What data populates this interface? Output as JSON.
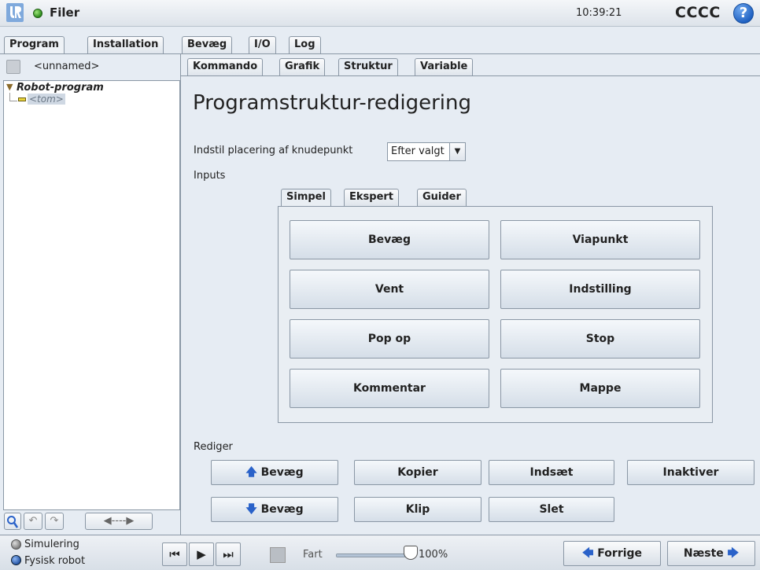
{
  "header": {
    "app_title": "Filer",
    "clock": "10:39:21",
    "robot_name": "CCCC",
    "help_glyph": "?"
  },
  "main_tabs": [
    "Program",
    "Installation",
    "Bevæg",
    "I/O",
    "Log"
  ],
  "sub_tabs": [
    "Kommando",
    "Grafik",
    "Struktur",
    "Variable"
  ],
  "left_panel": {
    "file_name": "<unnamed>",
    "tree_root": "Robot-program",
    "tree_child": "<tom>"
  },
  "main": {
    "title": "Programstruktur-redigering",
    "placement_label": "Indstil placering af knudepunkt",
    "placement_value": "Efter valgt",
    "inputs_label": "Inputs",
    "inner_tabs": [
      "Simpel",
      "Ekspert",
      "Guider"
    ],
    "commands": [
      "Bevæg",
      "Viapunkt",
      "Vent",
      "Indstilling",
      "Pop op",
      "Stop",
      "Kommentar",
      "Mappe"
    ],
    "edit_label": "Rediger",
    "edit_buttons": {
      "move_up": "Bevæg",
      "copy": "Kopier",
      "paste": "Indsæt",
      "disable": "Inaktiver",
      "move_down": "Bevæg",
      "cut": "Klip",
      "delete": "Slet"
    }
  },
  "footer": {
    "simulation": "Simulering",
    "real_robot": "Fysisk robot",
    "speed_label": "Fart",
    "speed_value": "100%",
    "speed_fraction": 1.0,
    "prev": "Forrige",
    "next": "Næste"
  },
  "colors": {
    "accent_blue": "#2a62c9",
    "active_green": "#2e8b1d",
    "panel_bg": "#e6ecf3"
  }
}
